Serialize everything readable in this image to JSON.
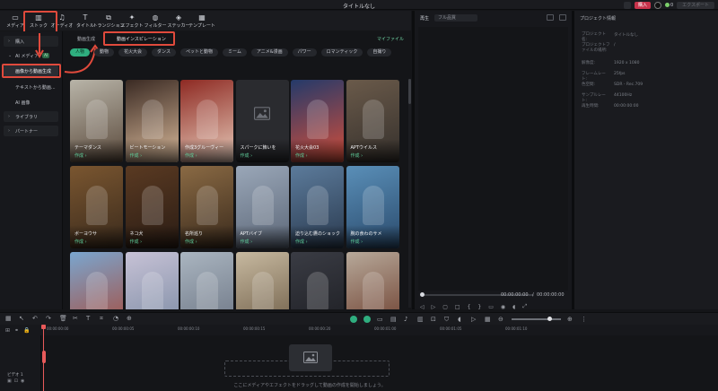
{
  "app": {
    "title": "タイトルなし"
  },
  "titlebar": {
    "buy_label": "購入",
    "points": "0",
    "export_label": "エクスポート"
  },
  "toolbar": {
    "tools": [
      {
        "label": "メディア",
        "icon": "media-icon"
      },
      {
        "label": "ストック",
        "icon": "stock-icon"
      },
      {
        "label": "オーディオ",
        "icon": "audio-icon"
      },
      {
        "label": "タイトル",
        "icon": "title-icon"
      },
      {
        "label": "トランジション",
        "icon": "transition-icon"
      },
      {
        "label": "エフェクト",
        "icon": "effect-icon"
      },
      {
        "label": "フィルター",
        "icon": "filter-icon"
      },
      {
        "label": "ステッカー",
        "icon": "sticker-icon"
      },
      {
        "label": "テンプレート",
        "icon": "template-icon"
      }
    ]
  },
  "sidebar": {
    "items": [
      {
        "label": "購入"
      },
      {
        "label": "AI メディア",
        "badge": "AI"
      },
      {
        "label": "画像から動画生成"
      },
      {
        "label": "テキストから動画..."
      },
      {
        "label": "AI 画像"
      },
      {
        "label": "ライブラリ"
      },
      {
        "label": "パートナー"
      }
    ]
  },
  "media_head": {
    "tabs": [
      "動画生成",
      "動画インスピレーション"
    ],
    "right_link": "マイファイル"
  },
  "categories": [
    "人物",
    "動物",
    "花火大会",
    "ダンス",
    "ペットと動物",
    "ミーム",
    "アニメ&漫画",
    "パワー",
    "ロマンティック",
    "自撮り"
  ],
  "cards": [
    {
      "name": "テーマダンス",
      "action": "作成 ›",
      "colors": [
        "#b8b4a8",
        "#5b4a3c"
      ]
    },
    {
      "name": "ビートモーション",
      "action": "作成 ›",
      "colors": [
        "#3a2a23",
        "#d9b99a"
      ]
    },
    {
      "name": "作成3グルーヴィー",
      "action": "作成 ›",
      "colors": [
        "#8e2a23",
        "#e6c9b8"
      ]
    },
    {
      "name": "スパークに飾いを",
      "action": "作成 ›",
      "colors": [
        "#2a2b2f",
        "#2a2b2f"
      ]
    },
    {
      "name": "花火大会03",
      "action": "作成 ›",
      "colors": [
        "#243a6a",
        "#d34e3a"
      ]
    },
    {
      "name": "APTウイルス",
      "action": "作成 ›",
      "colors": [
        "#6a5a4a",
        "#35302c"
      ]
    },
    {
      "name": "ボーヨウサ",
      "action": "作成 ›",
      "colors": [
        "#7a5630",
        "#3a2a1c"
      ]
    },
    {
      "name": "ネコ犬",
      "action": "作成 ›",
      "colors": [
        "#5a3a22",
        "#2a1c14"
      ]
    },
    {
      "name": "名所巡り",
      "action": "作成 ›",
      "colors": [
        "#8a6a44",
        "#3a2a1c"
      ]
    },
    {
      "name": "APTバイブ",
      "action": "作成 ›",
      "colors": [
        "#9aa7b8",
        "#5c6778"
      ]
    },
    {
      "name": "迫り込む鷹のショック",
      "action": "作成 ›",
      "colors": [
        "#5c7b9b",
        "#2a3a4f"
      ]
    },
    {
      "name": "腕の食わのサメ",
      "action": "作成 ›",
      "colors": [
        "#5a8fb8",
        "#2a4a6c"
      ]
    },
    {
      "name": "",
      "action": "",
      "colors": [
        "#7aa6cf",
        "#a84a3a"
      ]
    },
    {
      "name": "",
      "action": "",
      "colors": [
        "#c7c2d6",
        "#7a8aa2"
      ]
    },
    {
      "name": "",
      "action": "",
      "colors": [
        "#aab5c0",
        "#6a7382"
      ]
    },
    {
      "name": "",
      "action": "",
      "colors": [
        "#c7b9a0",
        "#6b5a44"
      ]
    },
    {
      "name": "",
      "action": "",
      "colors": [
        "#3a3c44",
        "#1c1d22"
      ]
    },
    {
      "name": "",
      "action": "",
      "colors": [
        "#b7a99a",
        "#6a3a2a"
      ]
    }
  ],
  "player": {
    "label": "再生",
    "quality": "フル品質",
    "time_current": "00:00:00:00",
    "time_total": "00:00:00:00"
  },
  "properties": {
    "title": "プロジェクト情報",
    "rows": [
      {
        "key": "プロジェクト名:",
        "value": "タイトルなし"
      },
      {
        "key": "プロジェクトファイルの場所:",
        "value": "/"
      },
      {
        "key": "解像度:",
        "value": "1920 x 1080"
      },
      {
        "key": "フレームレート:",
        "value": "25fps"
      },
      {
        "key": "色空間:",
        "value": "SDR - Rec.709"
      },
      {
        "key": "サンプルレート:",
        "value": "44100Hz"
      },
      {
        "key": "再生時間:",
        "value": "00:00:00:00"
      }
    ]
  },
  "timeline": {
    "ruler": [
      "00:00:00:00",
      "00:00:00:05",
      "00:00:00:10",
      "00:00:00:15",
      "00:00:00:20",
      "00:00:01:00",
      "00:00:01:05",
      "00:00:01:10"
    ],
    "track_label": "ビデオ 1",
    "drop_hint": "ここにメディアやエフェクトをドラッグして動画の作成を開始しましょう。"
  },
  "colors": {
    "accent": "#2fae7f",
    "highlight": "#e04a3c",
    "buy": "#c8334b"
  }
}
